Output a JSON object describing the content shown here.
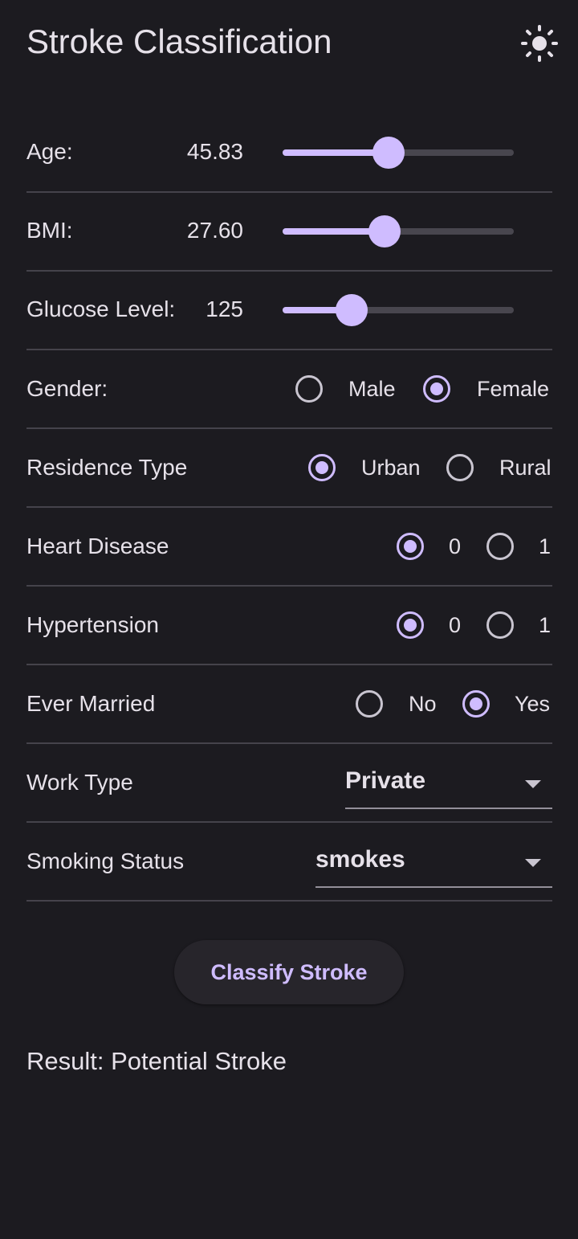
{
  "app": {
    "title": "Stroke Classification",
    "theme_icon": "sun-icon"
  },
  "sliders": [
    {
      "label": "Age:",
      "value": "45.83",
      "fraction": 0.46
    },
    {
      "label": "BMI:",
      "value": "27.60",
      "fraction": 0.44
    },
    {
      "label": "Glucose Level:",
      "value": "125",
      "fraction": 0.3
    }
  ],
  "gender": {
    "label": "Gender:",
    "options": [
      "Male",
      "Female"
    ],
    "selected": "Female"
  },
  "residence": {
    "label": "Residence Type",
    "options": [
      "Urban",
      "Rural"
    ],
    "selected": "Urban"
  },
  "heart_disease": {
    "label": "Heart Disease",
    "options": [
      "0",
      "1"
    ],
    "selected": "0"
  },
  "hypertension": {
    "label": "Hypertension",
    "options": [
      "0",
      "1"
    ],
    "selected": "0"
  },
  "ever_married": {
    "label": "Ever Married",
    "options": [
      "No",
      "Yes"
    ],
    "selected": "Yes"
  },
  "work_type": {
    "label": "Work Type",
    "value": "Private"
  },
  "smoking": {
    "label": "Smoking Status",
    "value": "smokes"
  },
  "classify_button": "Classify Stroke",
  "result": "Result: Potential Stroke",
  "colors": {
    "background": "#1c1b20",
    "accent": "#cfbcff",
    "divider": "#45434b"
  }
}
